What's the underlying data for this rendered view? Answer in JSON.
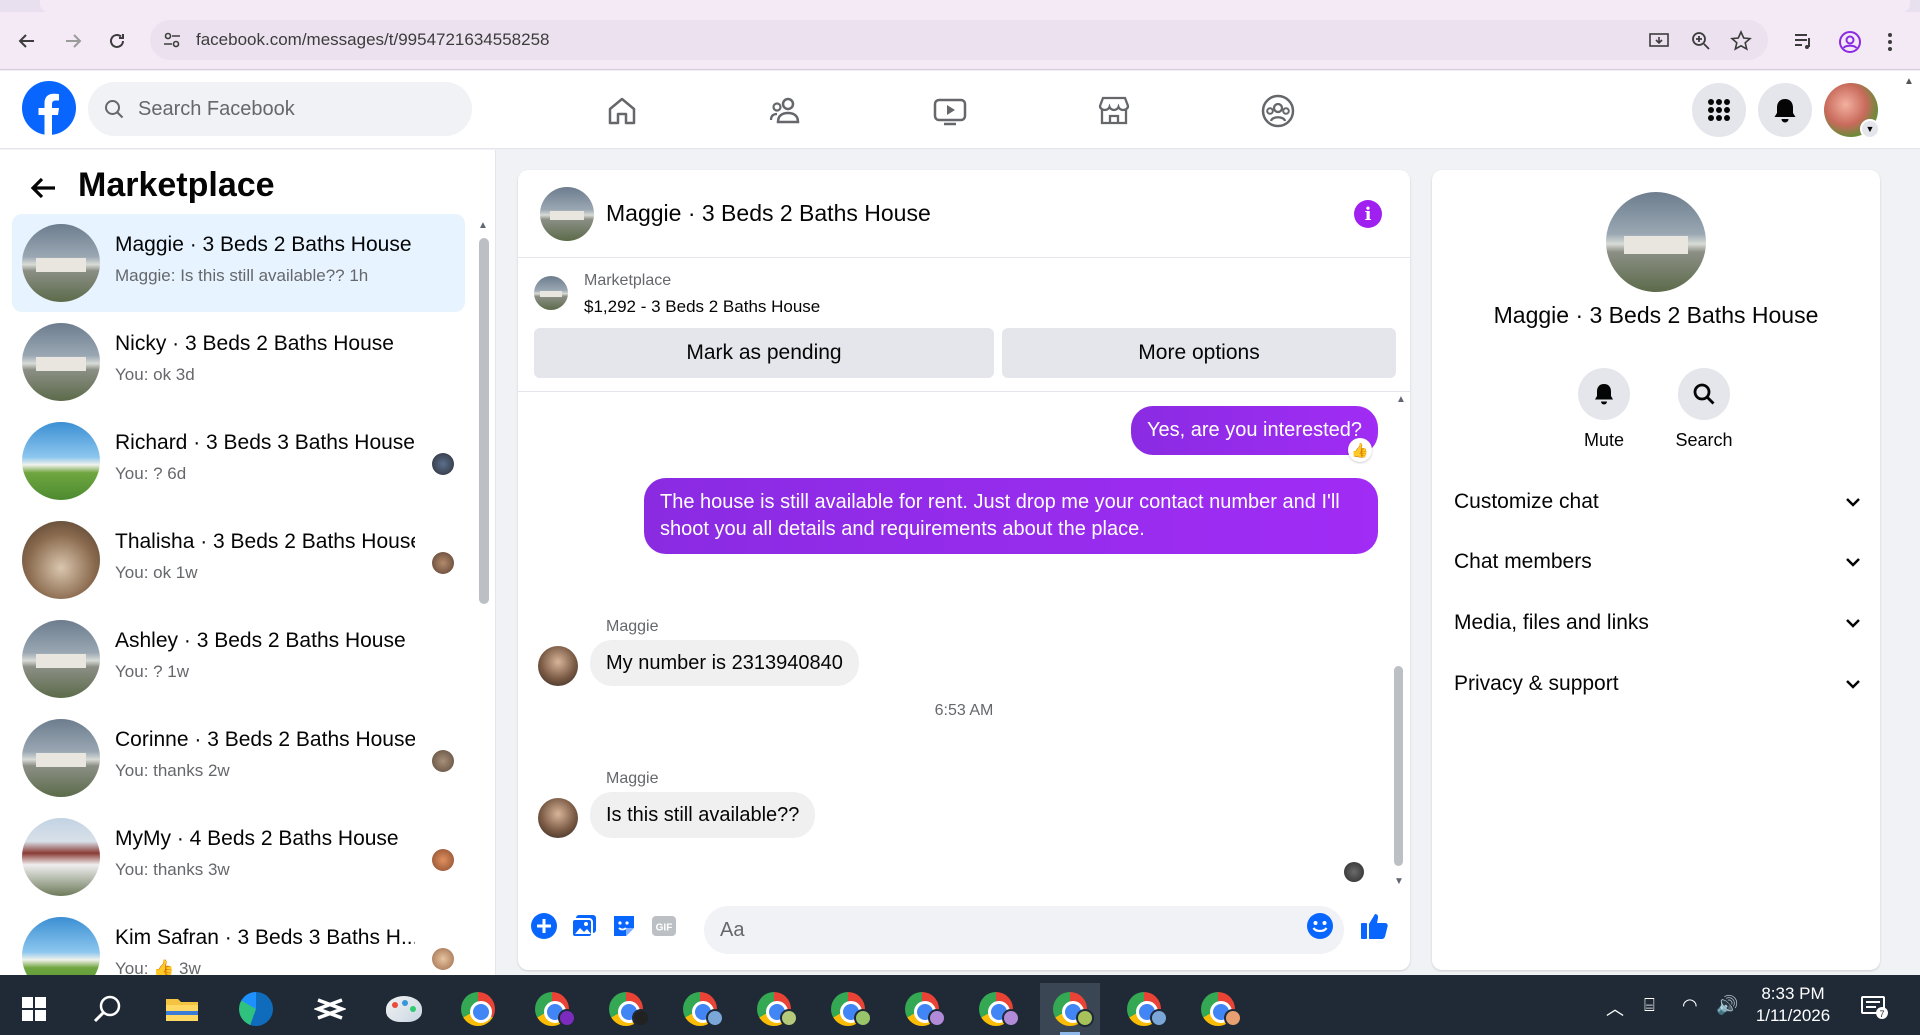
{
  "browser": {
    "url": "facebook.com/messages/t/9954721634558258"
  },
  "fb": {
    "search_placeholder": "Search Facebook",
    "accent": "#0866ff"
  },
  "left": {
    "title": "Marketplace",
    "conversations": [
      {
        "name": "Maggie · 3 Beds 2 Baths House",
        "preview": "Maggie: Is this still available?? 1h",
        "thumb": "house",
        "active": true
      },
      {
        "name": "Nicky · 3 Beds 2 Baths House",
        "preview": "You: ok 3d",
        "thumb": "house"
      },
      {
        "name": "Richard · 3 Beds 3 Baths House",
        "preview": "You: ? 6d",
        "thumb": "palm"
      },
      {
        "name": "Thalisha · 3 Beds 2 Baths House",
        "preview": "You: ok 1w",
        "thumb": "interior"
      },
      {
        "name": "Ashley · 3 Beds 2 Baths House",
        "preview": "You: ? 1w",
        "thumb": "house"
      },
      {
        "name": "Corinne · 3 Beds 2 Baths House",
        "preview": "You: thanks 2w",
        "thumb": "house"
      },
      {
        "name": "MyMy · 4 Beds 2 Baths House",
        "preview": "You: thanks 3w",
        "thumb": "victorian"
      },
      {
        "name": "Kim Safran · 3 Beds 3 Baths H...",
        "preview": "You: 👍 3w",
        "thumb": "palm"
      }
    ]
  },
  "chat": {
    "title": "Maggie · 3 Beds 2 Baths House",
    "marketplace_label": "Marketplace",
    "listing": "$1,292 - 3 Beds 2 Baths House",
    "mark_pending": "Mark as pending",
    "more_options": "More options",
    "messages": {
      "out1": "Yes, are you interested?",
      "out2": "The house is still available for rent. Just drop me your contact number and I'll shoot you all details and requirements about the place.",
      "sender1": "Maggie",
      "in1": "My number is 2313940840",
      "time": "6:53 AM",
      "sender2": "Maggie",
      "in2": "Is this still available??"
    },
    "input_placeholder": "Aa",
    "accent": "#9b2cf0"
  },
  "right": {
    "name": "Maggie · 3 Beds 2 Baths House",
    "mute": "Mute",
    "search": "Search",
    "sections": [
      "Customize chat",
      "Chat members",
      "Media, files and links",
      "Privacy & support"
    ]
  },
  "taskbar": {
    "time": "8:33 PM",
    "date": "1/11/2026"
  }
}
